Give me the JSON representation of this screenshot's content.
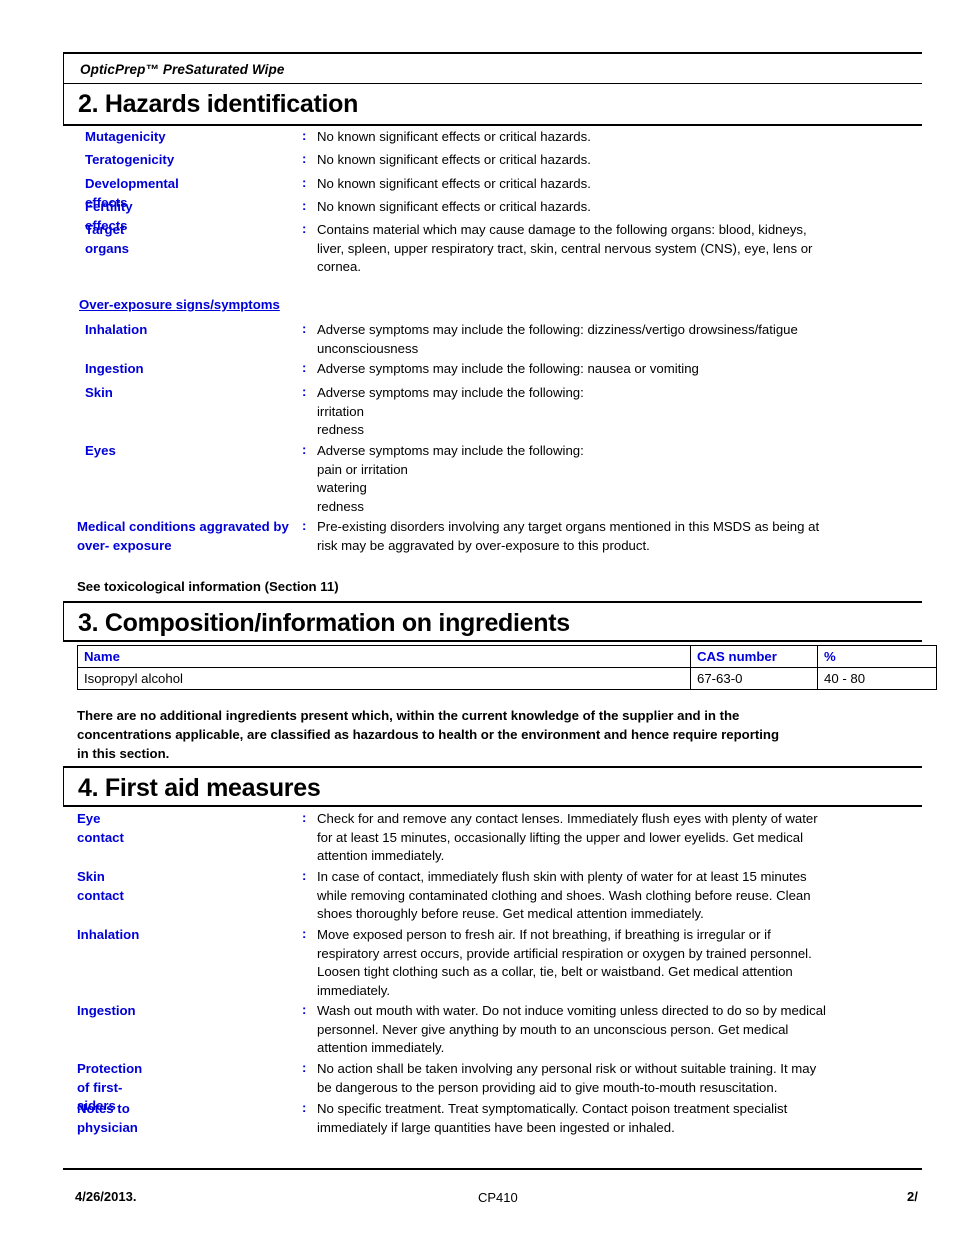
{
  "document": {
    "running_header": "OpticPrep™ PreSaturated Wipe"
  },
  "sections": {
    "hazards": {
      "title": "2. Hazards identification",
      "rows": [
        {
          "label": "Mutagenicity",
          "colon": ":",
          "lines": [
            "No known significant effects or critical hazards."
          ]
        },
        {
          "label": "Teratogenicity",
          "colon": ":",
          "lines": [
            "No known significant effects or critical hazards."
          ]
        },
        {
          "label": "Developmental effects",
          "colon": ":",
          "lines": [
            "No known significant effects or critical hazards."
          ]
        },
        {
          "label": "Fertility effects",
          "colon": ":",
          "lines": [
            "No known significant effects or critical hazards."
          ]
        },
        {
          "label": "Target organs",
          "colon": ":",
          "lines": [
            "Contains material which may cause damage to the following organs: blood, kidneys,",
            "liver, spleen, upper respiratory tract, skin, central nervous system (CNS), eye, lens or",
            "cornea."
          ]
        }
      ],
      "overexposure_heading": "Over-exposure signs/symptoms",
      "overexposure_rows": [
        {
          "label": "Inhalation",
          "colon": ":",
          "lines": [
            "Adverse symptoms may include the following: dizziness/vertigo drowsiness/fatigue",
            "unconsciousness"
          ]
        },
        {
          "label": "Ingestion",
          "colon": ":",
          "lines": [
            "Adverse symptoms may include the following: nausea or vomiting"
          ]
        },
        {
          "label": "Skin",
          "colon": ":",
          "lines": [
            "Adverse symptoms may include the following:",
            "irritation",
            "redness"
          ]
        },
        {
          "label": "Eyes",
          "colon": ":",
          "lines": [
            "Adverse symptoms may include the following:",
            "pain or irritation",
            "watering",
            "redness"
          ]
        }
      ],
      "medical_conditions": {
        "label_lines": [
          "Medical conditions",
          "aggravated by over-",
          "exposure"
        ],
        "colon": ":",
        "lines": [
          "Pre-existing disorders involving any target organs mentioned in this MSDS as being at",
          "risk may be aggravated by over-exposure to this product."
        ]
      },
      "see_also": "See toxicological information (Section 11)"
    },
    "composition": {
      "title": "3. Composition/information on ingredients",
      "table": {
        "headers": [
          "Name",
          "CAS number",
          "%"
        ],
        "rows": [
          [
            "Isopropyl alcohol",
            "67-63-0",
            "40 - 80"
          ]
        ]
      },
      "note_lines": [
        "There are no additional ingredients present which, within the current knowledge of the supplier and in the",
        "concentrations applicable, are classified as hazardous to health or the environment and hence require reporting",
        "in this section."
      ]
    },
    "first_aid": {
      "title": "4. First aid measures",
      "rows": [
        {
          "label": "Eye contact",
          "colon": ":",
          "lines": [
            "Check for and remove any contact lenses.  Immediately flush eyes with plenty of water",
            "for at least 15 minutes, occasionally lifting the upper and lower eyelids.  Get medical",
            "attention immediately."
          ]
        },
        {
          "label": "Skin contact",
          "colon": ":",
          "lines": [
            "In case of contact, immediately flush skin with plenty of water for at least 15 minutes",
            "while removing contaminated clothing and shoes.  Wash clothing before reuse.  Clean",
            "shoes thoroughly before reuse.  Get medical attention immediately."
          ]
        },
        {
          "label": "Inhalation",
          "colon": ":",
          "lines": [
            "Move exposed person to fresh air.  If not breathing, if breathing is irregular or if",
            "respiratory arrest occurs, provide artificial respiration or oxygen by trained personnel.",
            "Loosen tight clothing such as a collar, tie, belt or waistband.  Get medical attention",
            "immediately."
          ]
        },
        {
          "label": "Ingestion",
          "colon": ":",
          "lines": [
            "Wash out mouth with water.  Do not induce vomiting unless directed to do so by medical",
            "personnel.  Never give anything by mouth to an unconscious person.  Get medical",
            "attention immediately."
          ]
        },
        {
          "label": "Protection of first-aiders",
          "colon": ":",
          "lines": [
            "No action shall be taken involving any personal risk or without suitable training.  It may",
            "be dangerous to the person providing aid to give mouth-to-mouth resuscitation."
          ]
        },
        {
          "label": "Notes to physician",
          "colon": ":",
          "lines": [
            "No specific treatment.  Treat symptomatically.  Contact poison treatment specialist",
            "immediately if large quantities have been ingested or inhaled."
          ]
        }
      ]
    }
  },
  "footer": {
    "date": "4/26/2013.",
    "product_code": "CP410",
    "page": "2/"
  }
}
